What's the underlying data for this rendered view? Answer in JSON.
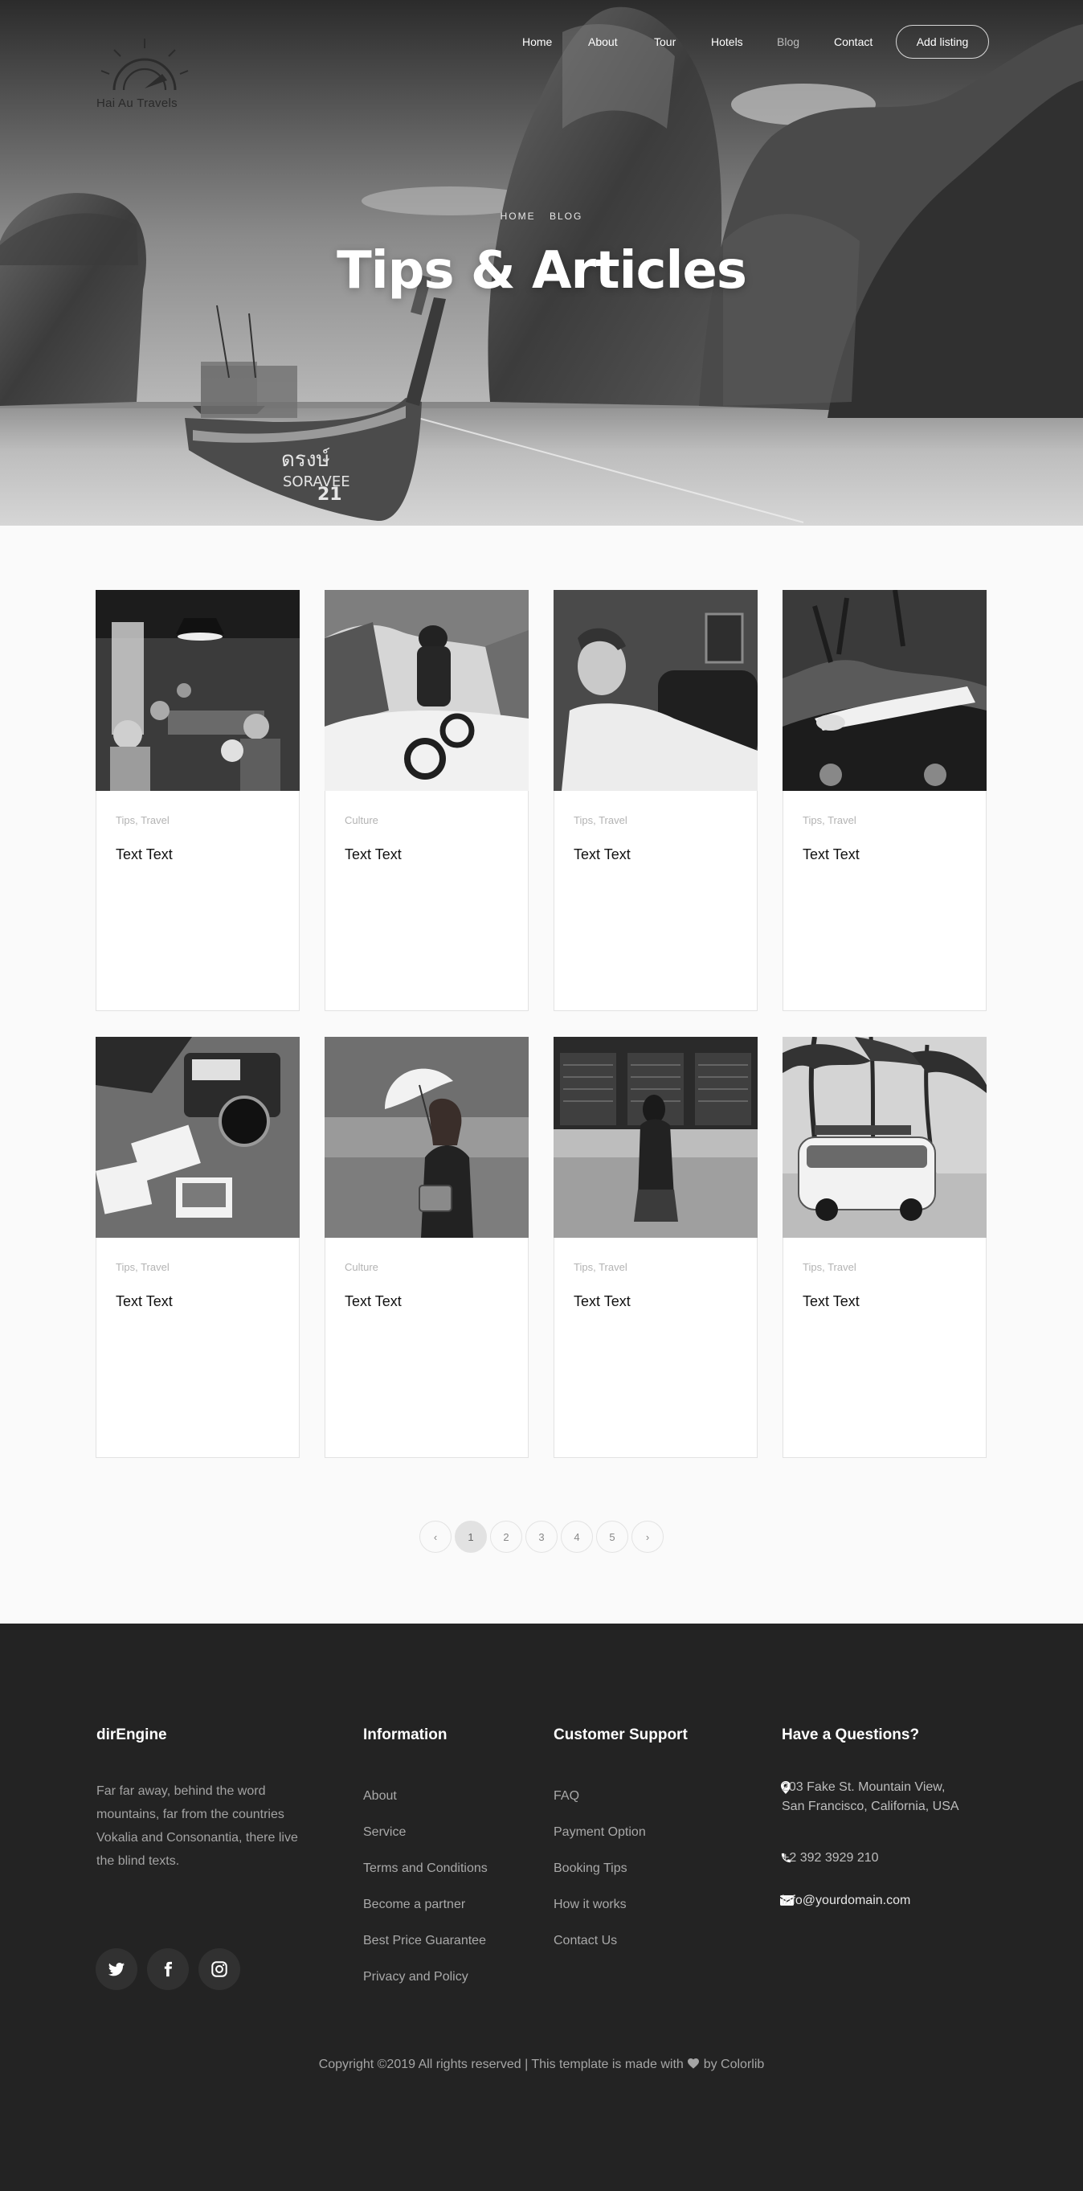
{
  "brand": {
    "name": "Hai Au Travels"
  },
  "nav": {
    "items": [
      {
        "label": "Home",
        "active": false
      },
      {
        "label": "About",
        "active": false
      },
      {
        "label": "Tour",
        "active": false
      },
      {
        "label": "Hotels",
        "active": false
      },
      {
        "label": "Blog",
        "active": true
      },
      {
        "label": "Contact",
        "active": false
      }
    ],
    "cta_label": "Add listing"
  },
  "hero": {
    "breadcrumb": [
      "HOME",
      "BLOG"
    ],
    "title": "Tips & Articles",
    "boat_text": [
      "ดรงษ์",
      "SORAVEE",
      "21"
    ]
  },
  "posts": [
    {
      "tags": "Tips, Travel",
      "title": "Text Text",
      "image": "restaurant-friends-photo"
    },
    {
      "tags": "Culture",
      "title": "Text Text",
      "image": "snow-bike-photo"
    },
    {
      "tags": "Tips, Travel",
      "title": "Text Text",
      "image": "man-on-couch-photo"
    },
    {
      "tags": "Tips, Travel",
      "title": "Text Text",
      "image": "woman-on-car-photo"
    },
    {
      "tags": "Tips, Travel",
      "title": "Text Text",
      "image": "camera-polaroids-photo"
    },
    {
      "tags": "Culture",
      "title": "Text Text",
      "image": "woman-umbrella-photo"
    },
    {
      "tags": "Tips, Travel",
      "title": "Text Text",
      "image": "airport-board-photo"
    },
    {
      "tags": "Tips, Travel",
      "title": "Text Text",
      "image": "van-palms-photo"
    }
  ],
  "pagination": {
    "prev": "‹",
    "next": "›",
    "pages": [
      "1",
      "2",
      "3",
      "4",
      "5"
    ],
    "current": "1"
  },
  "footer": {
    "about": {
      "heading": "dirEngine",
      "text": "Far far away, behind the word mountains, far from the countries Vokalia and Consonantia, there live the blind texts."
    },
    "social": [
      "twitter-icon",
      "facebook-icon",
      "instagram-icon"
    ],
    "information": {
      "heading": "Information",
      "links": [
        "About",
        "Service",
        "Terms and Conditions",
        "Become a partner",
        "Best Price Guarantee",
        "Privacy and Policy"
      ]
    },
    "support": {
      "heading": "Customer Support",
      "links": [
        "FAQ",
        "Payment Option",
        "Booking Tips",
        "How it works",
        "Contact Us"
      ]
    },
    "questions": {
      "heading": "Have a Questions?",
      "address": "203 Fake St. Mountain View, San Francisco, California, USA",
      "phone": "+2 392 3929 210",
      "email": "info@yourdomain.com"
    },
    "copyright_before": "Copyright ©2019 All rights reserved | This template is made with",
    "copyright_after": "by Colorlib"
  },
  "colors": {
    "footer_bg": "#232323",
    "page_bg": "#fafafa",
    "accent": "#ffffff"
  }
}
